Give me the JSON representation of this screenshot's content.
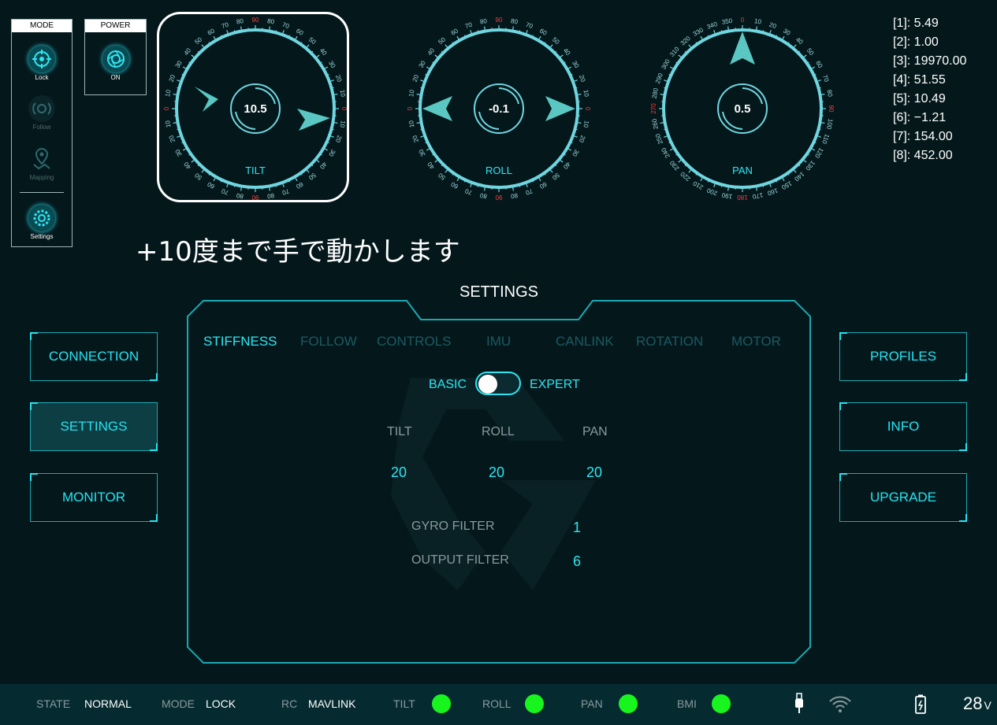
{
  "mode_panel": {
    "title": "MODE",
    "items": [
      {
        "label": "Lock",
        "icon": "crosshair-icon",
        "active": true
      },
      {
        "label": "Follow",
        "icon": "follow-icon",
        "active": false
      },
      {
        "label": "Mapping",
        "icon": "map-pin-icon",
        "active": false
      },
      {
        "label": "Settings",
        "icon": "gear-icon",
        "active": true
      }
    ]
  },
  "power_panel": {
    "title": "POWER",
    "state": "ON",
    "icon": "shutter-icon"
  },
  "gauges": {
    "tilt": {
      "label": "TILT",
      "value": "10.5"
    },
    "roll": {
      "label": "ROLL",
      "value": "-0.1"
    },
    "pan": {
      "label": "PAN",
      "value": "0.5"
    }
  },
  "readouts": [
    "[1]: 5.49",
    "[2]: 1.00",
    "[3]: 19970.00",
    "[4]: 51.55",
    "[5]: 10.49",
    "[6]: −1.21",
    "[7]: 154.00",
    "[8]: 452.00"
  ],
  "hint_text": "+10度まで手で動かします",
  "left_menu": {
    "connection": "CONNECTION",
    "settings": "SETTINGS",
    "monitor": "MONITOR"
  },
  "right_menu": {
    "profiles": "PROFILES",
    "info": "INFO",
    "upgrade": "UPGRADE"
  },
  "settings": {
    "title": "SETTINGS",
    "tabs": [
      "STIFFNESS",
      "FOLLOW",
      "CONTROLS",
      "IMU",
      "CANLINK",
      "ROTATION",
      "MOTOR"
    ],
    "active_tab": "STIFFNESS",
    "mode_left": "BASIC",
    "mode_right": "EXPERT",
    "axis_headers": {
      "tilt": "TILT",
      "roll": "ROLL",
      "pan": "PAN"
    },
    "axis_values": {
      "tilt": "20",
      "roll": "20",
      "pan": "20"
    },
    "gyro_filter_label": "GYRO FILTER",
    "gyro_filter_value": "1",
    "output_filter_label": "OUTPUT FILTER",
    "output_filter_value": "6"
  },
  "status_bar": {
    "state_key": "STATE",
    "state_val": "NORMAL",
    "mode_key": "MODE",
    "mode_val": "LOCK",
    "rc_key": "RC",
    "rc_val": "MAVLINK",
    "tilt": "TILT",
    "roll": "ROLL",
    "pan": "PAN",
    "bmi": "BMI",
    "voltage": "28",
    "voltage_unit": "V"
  },
  "colors": {
    "accent": "#2ee6f2",
    "gauge_ring": "#6fd6e0",
    "status_ok": "#18f51e",
    "background": "#04181c"
  }
}
